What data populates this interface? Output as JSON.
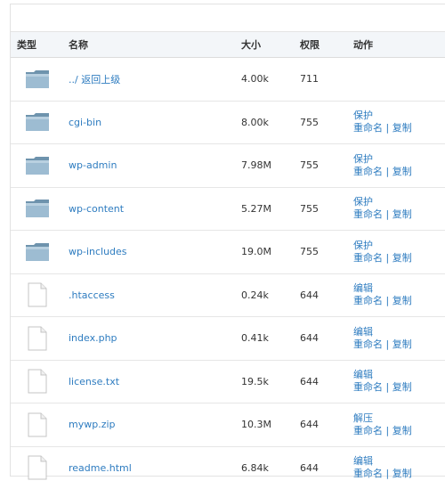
{
  "columns": {
    "type": "类型",
    "name": "名称",
    "size": "大小",
    "perm": "权限",
    "action": "动作"
  },
  "actions": {
    "protect": "保护",
    "edit": "编辑",
    "extract": "解压",
    "rename": "重命名",
    "separator": "|",
    "copy": "复制"
  },
  "rows": [
    {
      "kind": "folder",
      "name": "../ 返回上级",
      "size": "4.00k",
      "perm": "711",
      "primary": ""
    },
    {
      "kind": "folder",
      "name": "cgi-bin",
      "size": "8.00k",
      "perm": "755",
      "primary": "保护"
    },
    {
      "kind": "folder",
      "name": "wp-admin",
      "size": "7.98M",
      "perm": "755",
      "primary": "保护"
    },
    {
      "kind": "folder",
      "name": "wp-content",
      "size": "5.27M",
      "perm": "755",
      "primary": "保护"
    },
    {
      "kind": "folder",
      "name": "wp-includes",
      "size": "19.0M",
      "perm": "755",
      "primary": "保护"
    },
    {
      "kind": "file",
      "name": ".htaccess",
      "size": "0.24k",
      "perm": "644",
      "primary": "编辑"
    },
    {
      "kind": "file",
      "name": "index.php",
      "size": "0.41k",
      "perm": "644",
      "primary": "编辑"
    },
    {
      "kind": "file",
      "name": "license.txt",
      "size": "19.5k",
      "perm": "644",
      "primary": "编辑"
    },
    {
      "kind": "file",
      "name": "mywp.zip",
      "size": "10.3M",
      "perm": "644",
      "primary": "解压"
    },
    {
      "kind": "file",
      "name": "readme.html",
      "size": "6.84k",
      "perm": "644",
      "primary": "编辑"
    }
  ],
  "colors": {
    "link": "#2e7cc0",
    "header_bg": "#f3f6f9",
    "folder": "#8fb1c9"
  },
  "icons": {
    "folder": "folder-icon",
    "file": "file-icon"
  }
}
